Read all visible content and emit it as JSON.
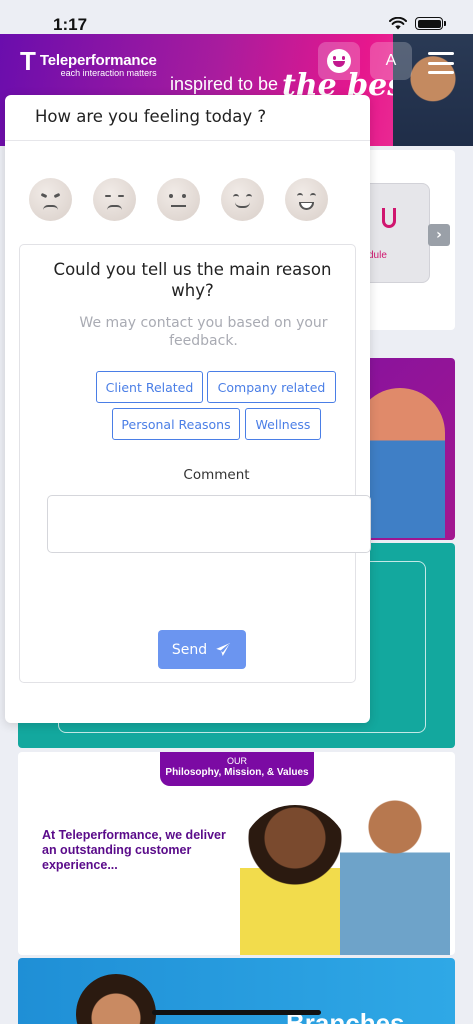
{
  "status": {
    "time": "1:17"
  },
  "header": {
    "brand_mark": "T",
    "brand_name": "Teleperformance",
    "brand_tagline": "each interaction matters",
    "slogan": "inspired to be",
    "slogan_script": "the best",
    "avatar_initial": "A",
    "accent": "#c2188e"
  },
  "background": {
    "module_label": "dule",
    "values_badge_small": "OUR",
    "values_badge_main": "Philosophy, Mission, & Values",
    "values_text": "At Teleperformance, we deliver an outstanding customer experience...",
    "branches_title": "Branches"
  },
  "modal": {
    "title": "How are you feeling today ?",
    "emojis": [
      "angry-face-icon",
      "sad-face-icon",
      "neutral-face-icon",
      "happy-face-icon",
      "very-happy-face-icon"
    ],
    "reason_title": "Could you tell us the main reason why?",
    "reason_subtitle": "We may contact you based on your feedback.",
    "chips": [
      "Client Related",
      "Company related",
      "Personal Reasons",
      "Wellness"
    ],
    "chip_color": "#4a7ee6",
    "comment_label": "Comment",
    "comment_value": "",
    "send_label": "Send",
    "send_color": "#6b95f0"
  }
}
